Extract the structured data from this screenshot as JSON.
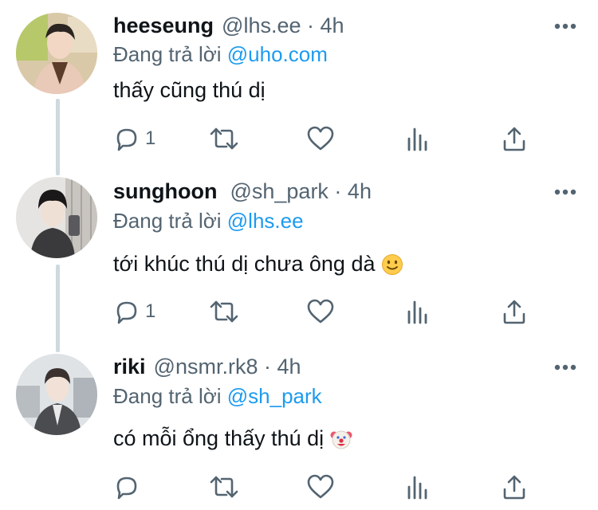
{
  "colors": {
    "text": "#0f1419",
    "secondary": "#536471",
    "link": "#1d9bf0",
    "thread_line": "#cfd9de"
  },
  "replies": [
    {
      "name": "heeseung",
      "meta": "@lhs.ee · 4h",
      "reply_prefix": "Đang trả lời",
      "reply_to": "@uho.com",
      "text": "thấy cũng thú dị",
      "emoji": "",
      "reply_count": "1",
      "icons": [
        "reply-icon",
        "retweet-icon",
        "like-icon",
        "analytics-icon",
        "share-icon"
      ]
    },
    {
      "name": "sunghoon",
      "meta": "@sh_park · 4h",
      "reply_prefix": "Đang trả lời",
      "reply_to": "@lhs.ee",
      "text": "tới khúc thú dị chưa ông dà",
      "emoji": "slightly-smiling-face-emoji",
      "reply_count": "1",
      "icons": [
        "reply-icon",
        "retweet-icon",
        "like-icon",
        "analytics-icon",
        "share-icon"
      ]
    },
    {
      "name": "riki",
      "meta": "@nsmr.rk8 · 4h",
      "reply_prefix": "Đang trả lời",
      "reply_to": "@sh_park",
      "text": "có mỗi ổng thấy thú dị",
      "emoji": "clown-face-emoji",
      "reply_count": "",
      "icons": [
        "reply-icon",
        "retweet-icon",
        "like-icon",
        "analytics-icon",
        "share-icon"
      ]
    }
  ]
}
